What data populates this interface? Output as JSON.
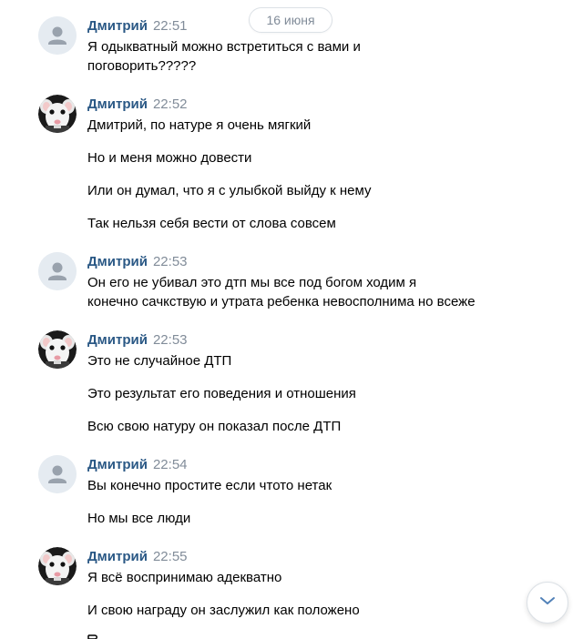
{
  "date_label": "16 июня",
  "groups": [
    {
      "avatar": "default-avatar",
      "author": "Дмитрий",
      "time": "22:51",
      "messages": [
        "Я одыкватный можно встретиться с вами и\nпоговорить?????"
      ]
    },
    {
      "avatar": "rat-avatar",
      "author": "Дмитрий",
      "time": "22:52",
      "messages": [
        "Дмитрий, по натуре я очень мягкий",
        "Но и меня можно довести",
        "Или он думал, что я с улыбкой выйду к нему",
        "Так нельзя себя вести от слова совсем"
      ]
    },
    {
      "avatar": "default-avatar",
      "author": "Дмитрий",
      "time": "22:53",
      "messages": [
        "Он его не убивал это дтп мы все под богом ходим я\nконечно сачкствую и утрата ребенка невосполнима но всеже"
      ]
    },
    {
      "avatar": "rat-avatar",
      "author": "Дмитрий",
      "time": "22:53",
      "messages": [
        "Это не случайное ДТП",
        "Это результат его поведения и отношения",
        "Всю свою натуру он показал после ДТП"
      ]
    },
    {
      "avatar": "default-avatar",
      "author": "Дмитрий",
      "time": "22:54",
      "messages": [
        "Вы конечно простите если чтото нетак",
        "Но мы все люди"
      ]
    },
    {
      "avatar": "rat-avatar",
      "author": "Дмитрий",
      "time": "22:55",
      "messages": [
        "Я всё воспринимаю адекватно",
        "И свою награду он заслужил как положено"
      ]
    }
  ],
  "icons": {
    "scroll_down": "chevron-down-icon"
  },
  "colors": {
    "author": "#2a5885",
    "time": "#818c99",
    "chevron": "#5181b8"
  }
}
